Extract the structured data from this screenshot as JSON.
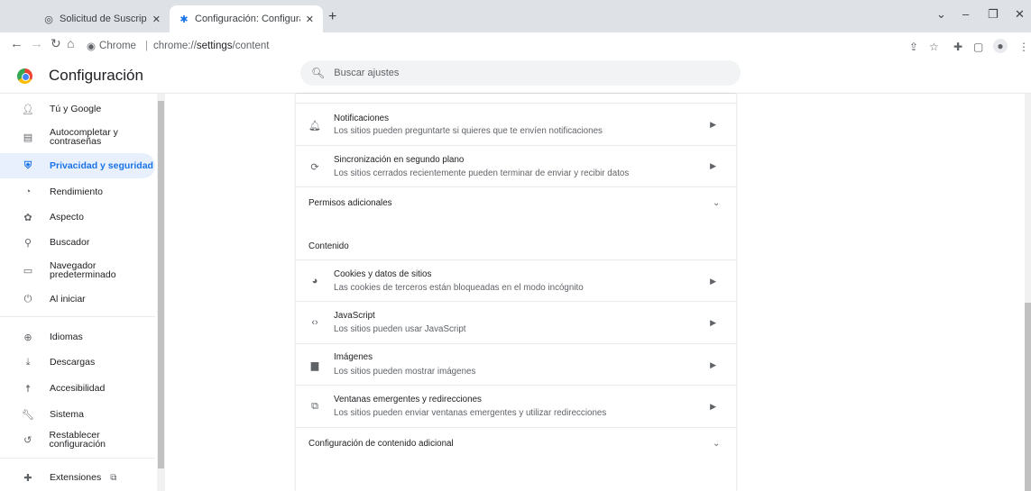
{
  "tabs": [
    {
      "title": "Solicitud de Suscripción de Deud",
      "icon": "globe-icon"
    },
    {
      "title": "Configuración: Configuración de",
      "icon": "gear-icon"
    }
  ],
  "toolbar": {
    "chip": "Chrome",
    "url_prefix": "chrome://",
    "url_path": "settings",
    "url_suffix": "/content"
  },
  "header": {
    "title": "Configuración",
    "search_placeholder": "Buscar ajustes"
  },
  "sidebar": {
    "items": [
      {
        "label": "Tú y Google",
        "icon": "person-icon"
      },
      {
        "label": "Autocompletar y contraseñas",
        "icon": "clipboard-icon"
      },
      {
        "label": "Privacidad y seguridad",
        "icon": "shield-icon"
      },
      {
        "label": "Rendimiento",
        "icon": "speedometer-icon"
      },
      {
        "label": "Aspecto",
        "icon": "palette-icon"
      },
      {
        "label": "Buscador",
        "icon": "search-icon"
      },
      {
        "label": "Navegador predeterminado",
        "icon": "browser-icon"
      },
      {
        "label": "Al iniciar",
        "icon": "power-icon"
      },
      {
        "label": "Idiomas",
        "icon": "globe-icon"
      },
      {
        "label": "Descargas",
        "icon": "download-icon"
      },
      {
        "label": "Accesibilidad",
        "icon": "accessibility-icon"
      },
      {
        "label": "Sistema",
        "icon": "wrench-icon"
      },
      {
        "label": "Restablecer configuración",
        "icon": "restore-icon"
      },
      {
        "label": "Extensiones",
        "icon": "puzzle-icon"
      }
    ]
  },
  "content": {
    "rows": [
      {
        "title": "Notificaciones",
        "subtitle": "Los sitios pueden preguntarte si quieres que te envíen notificaciones",
        "icon": "bell-icon"
      },
      {
        "title": "Sincronización en segundo plano",
        "subtitle": "Los sitios cerrados recientemente pueden terminar de enviar y recibir datos",
        "icon": "sync-icon"
      }
    ],
    "additional_permissions": "Permisos adicionales",
    "section_title": "Contenido",
    "content_rows": [
      {
        "title": "Cookies y datos de sitios",
        "subtitle": "Las cookies de terceros están bloqueadas en el modo incógnito",
        "icon": "cookie-icon"
      },
      {
        "title": "JavaScript",
        "subtitle": "Los sitios pueden usar JavaScript",
        "icon": "code-icon"
      },
      {
        "title": "Imágenes",
        "subtitle": "Los sitios pueden mostrar imágenes",
        "icon": "image-icon"
      },
      {
        "title": "Ventanas emergentes y redirecciones",
        "subtitle": "Los sitios pueden enviar ventanas emergentes y utilizar redirecciones",
        "icon": "popup-icon"
      }
    ],
    "additional_content": "Configuración de contenido adicional"
  }
}
